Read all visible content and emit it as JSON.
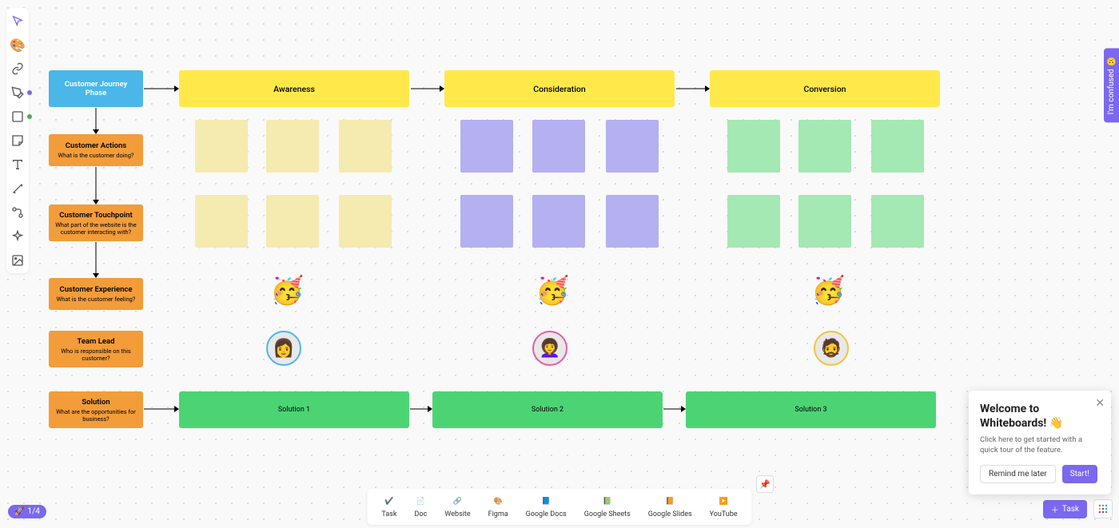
{
  "toolbar_icons": [
    "pointer",
    "palette",
    "link",
    "pen",
    "shape",
    "sticky",
    "text",
    "connector",
    "component",
    "ai",
    "image"
  ],
  "rows": {
    "header": {
      "title": "Customer Journey Phase"
    },
    "actions": {
      "title": "Customer Actions",
      "sub": "What is the customer doing?"
    },
    "touchpoint": {
      "title": "Customer Touchpoint",
      "sub": "What part of the website is the customer interacting with?"
    },
    "experience": {
      "title": "Customer Experience",
      "sub": "What is the customer feeling?"
    },
    "teamlead": {
      "title": "Team Lead",
      "sub": "Who is responsible on this customer?"
    },
    "solution": {
      "title": "Solution",
      "sub": "What are the opportunities for business?"
    }
  },
  "phases": [
    "Awareness",
    "Consideration",
    "Conversion"
  ],
  "solutions": [
    "Solution 1",
    "Solution 2",
    "Solution 3"
  ],
  "emoji": "🥳",
  "feedback_label": "I'm confused",
  "progress_text": "1/4",
  "dock": [
    "Task",
    "Doc",
    "Website",
    "Figma",
    "Google Docs",
    "Google Sheets",
    "Google Slides",
    "YouTube"
  ],
  "task_button": "Task",
  "popup": {
    "title": "Welcome to Whiteboards! 👋",
    "body": "Click here to get started with a quick tour of the feature.",
    "remind": "Remind me later",
    "start": "Start!"
  }
}
